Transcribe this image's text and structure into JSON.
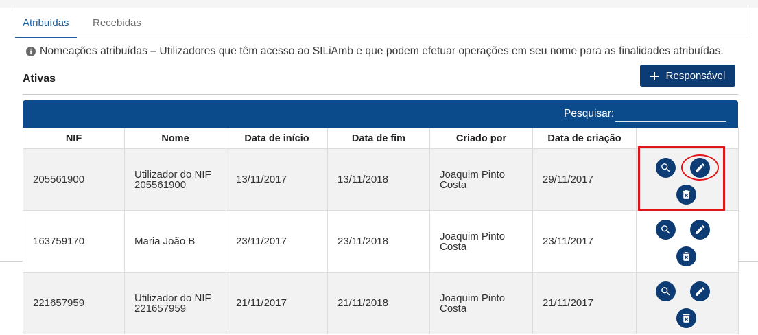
{
  "tabs": [
    {
      "label": "Atribuídas",
      "active": true
    },
    {
      "label": "Recebidas",
      "active": false
    }
  ],
  "info": {
    "icon": "info-icon",
    "text": "Nomeações atribuídas – Utilizadores que têm acesso ao SILiAmb e que podem efetuar operações em seu nome para as finalidades atribuídas."
  },
  "section": {
    "title": "Ativas"
  },
  "add_button": {
    "icon": "plus-icon",
    "label": "Responsável"
  },
  "table": {
    "search_label": "Pesquisar:",
    "columns": [
      "NIF",
      "Nome",
      "Data de início",
      "Data de fim",
      "Criado por",
      "Data de criação"
    ],
    "row_action_icons": [
      "search-icon",
      "edit-icon",
      "delete-icon"
    ],
    "rows": [
      {
        "nif": "205561900",
        "nome": "Utilizador do NIF 205561900",
        "data_inicio": "13/11/2017",
        "data_fim": "13/11/2018",
        "criado_por": "Joaquim Pinto Costa",
        "data_criacao": "29/11/2017"
      },
      {
        "nif": "163759170",
        "nome": "Maria João B",
        "data_inicio": "23/11/2017",
        "data_fim": "23/11/2018",
        "criado_por": "Joaquim Pinto Costa",
        "data_criacao": "23/11/2017"
      },
      {
        "nif": "221657959",
        "nome": "Utilizador do NIF 221657959",
        "data_inicio": "21/11/2017",
        "data_fim": "21/11/2018",
        "criado_por": "Joaquim Pinto Costa",
        "data_criacao": "21/11/2017"
      }
    ]
  },
  "colors": {
    "primary_button": "#0d3c75",
    "table_header": "#0b4b8c",
    "active_tab": "#1d5e9e",
    "row_alt": "#f2f2f2",
    "annotation": "#e0161c"
  }
}
